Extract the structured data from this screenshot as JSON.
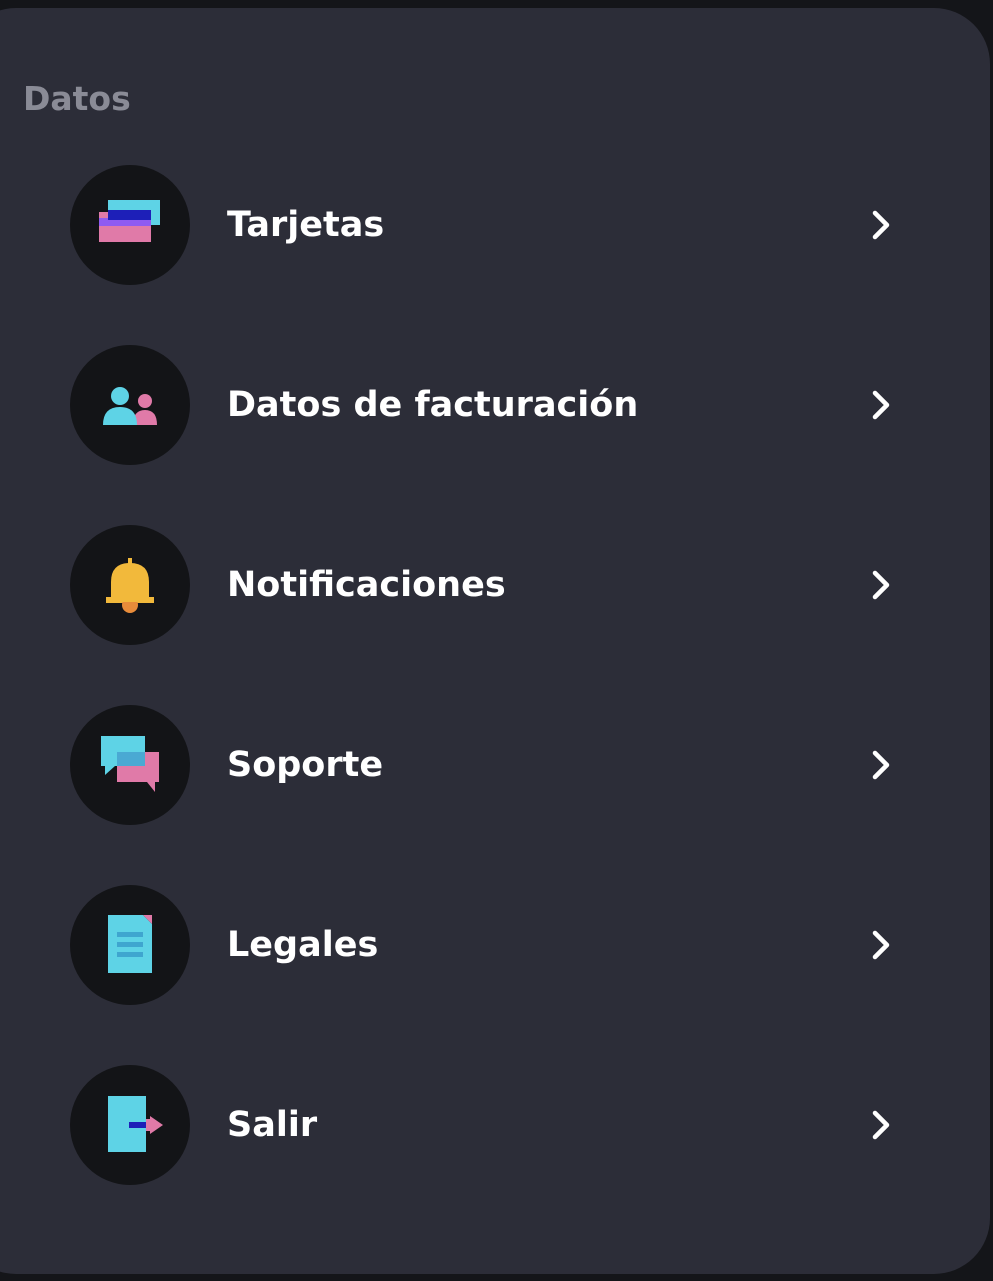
{
  "section": {
    "title": "Datos"
  },
  "items": [
    {
      "label": "Tarjetas",
      "icon": "cards-icon"
    },
    {
      "label": "Datos de facturación",
      "icon": "people-icon"
    },
    {
      "label": "Notificaciones",
      "icon": "bell-icon"
    },
    {
      "label": "Soporte",
      "icon": "chat-bubbles-icon"
    },
    {
      "label": "Legales",
      "icon": "document-icon"
    },
    {
      "label": "Salir",
      "icon": "exit-door-icon"
    }
  ],
  "colors": {
    "background": "#141519",
    "panel": "#2c2d38",
    "icon_circle": "#131417",
    "section_title": "#8a8b96",
    "cyan": "#5ed3e6",
    "pink": "#e07aa8",
    "purple": "#8f5bf0",
    "navy": "#1d1fb8",
    "yellow": "#f2b93b",
    "orange": "#e88c3a"
  }
}
